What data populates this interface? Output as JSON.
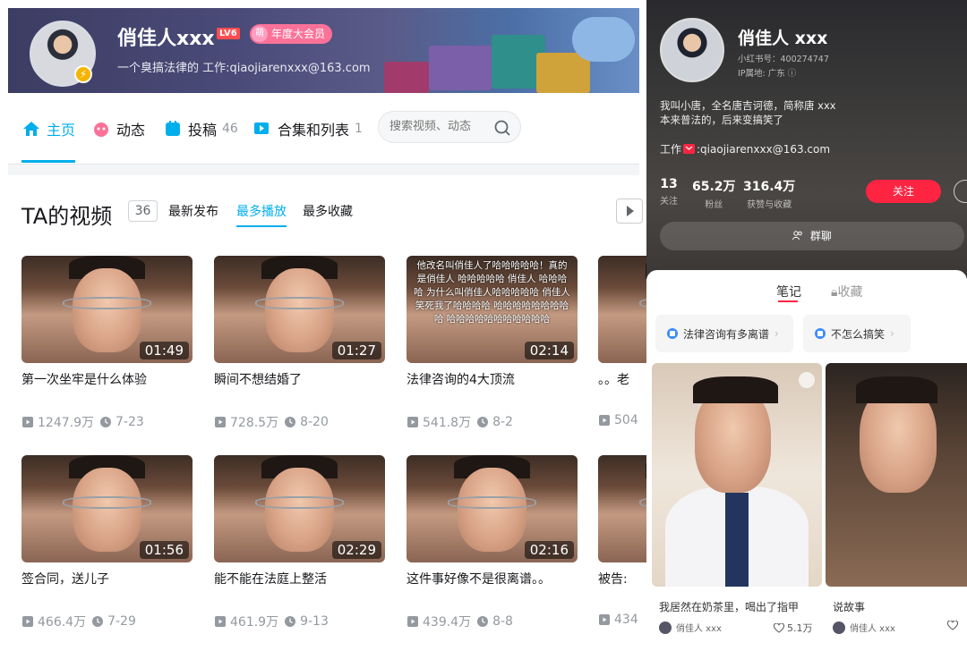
{
  "left": {
    "user": {
      "name": "俏佳人xxx",
      "level": "LV6",
      "vip_badge": "年度大会员",
      "vip_icon_text": "萌",
      "bio": "一个臭搞法律的 工作:qiaojiarenxxx@163.com"
    },
    "nav": {
      "home": "主页",
      "dynamic": "动态",
      "posts": "投稿",
      "posts_count": "46",
      "collections": "合集和列表",
      "collections_count": "1",
      "search_placeholder": "搜索视频、动态"
    },
    "section": {
      "title": "TA的视频",
      "count": "36",
      "sorts": [
        "最新发布",
        "最多播放",
        "最多收藏"
      ],
      "active_sort": "最多播放"
    },
    "videos": [
      {
        "title": "第一次坐牢是什么体验",
        "duration": "01:49",
        "views": "1247.9万",
        "date": "7-23"
      },
      {
        "title": "瞬间不想结婚了",
        "duration": "01:27",
        "views": "728.5万",
        "date": "8-20"
      },
      {
        "title": "法律咨询的4大顶流",
        "duration": "02:14",
        "views": "541.8万",
        "date": "8-2",
        "subtitles": "他改名叫俏佳人了哈哈哈哈哈！真的是俏佳人 哈哈哈哈哈 俏佳人 哈哈哈哈 为什么叫俏佳人哈哈哈哈哈 俏佳人笑死我了哈哈哈哈 哈哈哈哈哈哈哈哈哈 哈哈哈哈哈哈哈哈哈哈哈"
      },
      {
        "title": "。。老",
        "duration": "",
        "views": "504",
        "date": ""
      },
      {
        "title": "签合同，送儿子",
        "duration": "01:56",
        "views": "466.4万",
        "date": "7-29"
      },
      {
        "title": "能不能在法庭上整活",
        "duration": "02:29",
        "views": "461.9万",
        "date": "9-13"
      },
      {
        "title": "这件事好像不是很离谱。。",
        "duration": "02:16",
        "views": "439.4万",
        "date": "8-8"
      },
      {
        "title": "被告:",
        "duration": "",
        "views": "434",
        "date": ""
      }
    ]
  },
  "right": {
    "name": "俏佳人 xxx",
    "red_id": "小红书号：400274747",
    "ip": "IP属地: 广东",
    "bio_line1": "我叫小唐，全名唐吉诃德，简称唐 xxx",
    "bio_line2": "本来普法的，后来变搞笑了",
    "work_prefix": "工作",
    "work_email": ":qiaojiarenxxx@163.com",
    "stats": [
      {
        "value": "13",
        "label": "关注"
      },
      {
        "value": "65.2万",
        "label": "粉丝"
      },
      {
        "value": "316.4万",
        "label": "获赞与收藏"
      }
    ],
    "follow": "关注",
    "group_chat": "群聊",
    "tabs": [
      "笔记",
      "收藏"
    ],
    "collections": [
      "法律咨询有多离谱",
      "不怎么搞笑"
    ],
    "notes": [
      {
        "title": "我居然在奶茶里，喝出了指甲",
        "author": "俏佳人 xxx",
        "likes": "5.1万"
      },
      {
        "title": "说故事",
        "author": "俏佳人 xxx",
        "likes": ""
      }
    ]
  },
  "colors": {
    "bili_blue": "#00aeec",
    "xhs_red": "#ff2442",
    "vip_pink": "#fb7299"
  }
}
